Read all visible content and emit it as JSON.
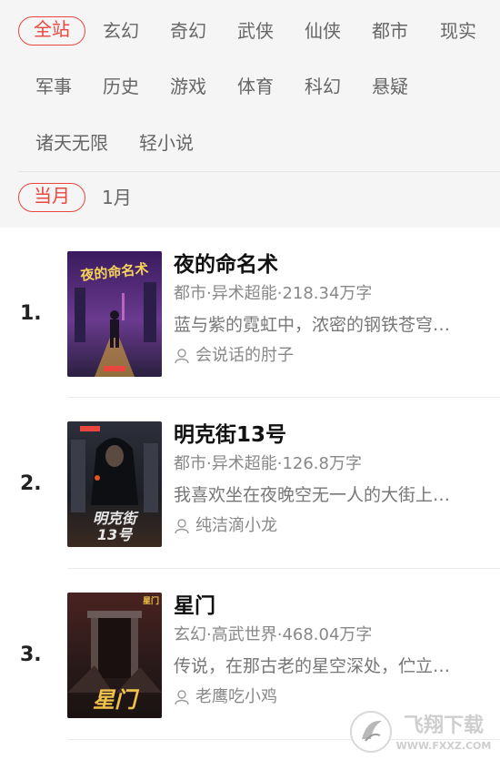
{
  "filters": {
    "categories": [
      "全站",
      "玄幻",
      "奇幻",
      "武侠",
      "仙侠",
      "都市",
      "现实",
      "军事",
      "历史",
      "游戏",
      "体育",
      "科幻",
      "悬疑",
      "诸天无限",
      "轻小说"
    ],
    "periods": [
      "当月",
      "1月"
    ]
  },
  "books": [
    {
      "rank": "1.",
      "title": "夜的命名术",
      "meta": "都市·异术超能·218.34万字",
      "desc": "蓝与紫的霓虹中，浓密的钢铁苍穹…",
      "author": "会说话的肘子",
      "cover_text": "夜的命名术"
    },
    {
      "rank": "2.",
      "title": "明克街13号",
      "meta": "都市·异术超能·126.8万字",
      "desc": "我喜欢坐在夜晚空无一人的大街上…",
      "author": "纯洁滴小龙",
      "cover_text": "明克街13号"
    },
    {
      "rank": "3.",
      "title": "星门",
      "meta": "玄幻·高武世界·468.04万字",
      "desc": "传说，在那古老的星空深处，伫立…",
      "author": "老鹰吃小鸡",
      "cover_text": "星门"
    }
  ],
  "watermark": {
    "text": "飞翔下载",
    "url": "WWW.FXXZ.COM"
  }
}
